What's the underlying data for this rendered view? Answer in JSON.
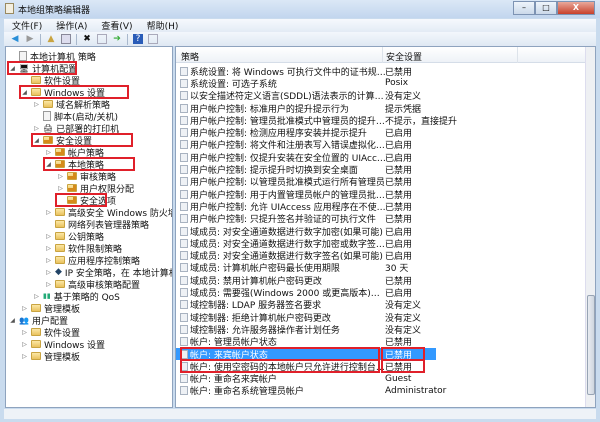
{
  "window": {
    "title": "本地组策略编辑器",
    "min": "–",
    "max": "□",
    "close": "X"
  },
  "menu": [
    "文件(F)",
    "操作(A)",
    "查看(V)",
    "帮助(H)"
  ],
  "toolbar": [
    "back-icon",
    "forward-icon",
    "up-icon",
    "show-hide-tree-icon",
    "delete-icon",
    "properties-icon",
    "export-icon",
    "help-icon",
    "view-icon"
  ],
  "tree": [
    {
      "label": "本地计算机 策略",
      "depth": 0,
      "arrow": "",
      "icon": "doc"
    },
    {
      "label": "计算机配置",
      "depth": 0,
      "arrow": "◢",
      "icon": "computer",
      "highlight": true
    },
    {
      "label": "软件设置",
      "depth": 1,
      "arrow": "",
      "icon": "folder"
    },
    {
      "label": "Windows 设置",
      "depth": 1,
      "arrow": "◢",
      "icon": "folder",
      "highlight": true
    },
    {
      "label": "域名解析策略",
      "depth": 2,
      "arrow": "▷",
      "icon": "folder"
    },
    {
      "label": "脚本(启动/关机)",
      "depth": 2,
      "arrow": "",
      "icon": "doc"
    },
    {
      "label": "已部署的打印机",
      "depth": 2,
      "arrow": "▷",
      "icon": "printer"
    },
    {
      "label": "安全设置",
      "depth": 2,
      "arrow": "◢",
      "icon": "secfolder",
      "highlight": true
    },
    {
      "label": "帐户策略",
      "depth": 3,
      "arrow": "▷",
      "icon": "secfolder"
    },
    {
      "label": "本地策略",
      "depth": 3,
      "arrow": "◢",
      "icon": "secfolder",
      "highlight": true
    },
    {
      "label": "审核策略",
      "depth": 4,
      "arrow": "▷",
      "icon": "secfolder"
    },
    {
      "label": "用户权限分配",
      "depth": 4,
      "arrow": "▷",
      "icon": "secfolder"
    },
    {
      "label": "安全选项",
      "depth": 4,
      "arrow": "",
      "icon": "secfolder",
      "highlight": true
    },
    {
      "label": "高级安全 Windows 防火墙",
      "depth": 3,
      "arrow": "▷",
      "icon": "folder"
    },
    {
      "label": "网络列表管理器策略",
      "depth": 3,
      "arrow": "",
      "icon": "folder"
    },
    {
      "label": "公钥策略",
      "depth": 3,
      "arrow": "▷",
      "icon": "folder"
    },
    {
      "label": "软件限制策略",
      "depth": 3,
      "arrow": "▷",
      "icon": "folder"
    },
    {
      "label": "应用程序控制策略",
      "depth": 3,
      "arrow": "▷",
      "icon": "folder"
    },
    {
      "label": "IP 安全策略，在 本地计算机",
      "depth": 3,
      "arrow": "▷",
      "icon": "ipsec"
    },
    {
      "label": "高级审核策略配置",
      "depth": 3,
      "arrow": "▷",
      "icon": "folder"
    },
    {
      "label": "基于策略的 QoS",
      "depth": 2,
      "arrow": "▷",
      "icon": "chart"
    },
    {
      "label": "管理模板",
      "depth": 1,
      "arrow": "▷",
      "icon": "folder"
    },
    {
      "label": "用户配置",
      "depth": 0,
      "arrow": "◢",
      "icon": "user"
    },
    {
      "label": "软件设置",
      "depth": 1,
      "arrow": "▷",
      "icon": "folder"
    },
    {
      "label": "Windows 设置",
      "depth": 1,
      "arrow": "▷",
      "icon": "folder"
    },
    {
      "label": "管理模板",
      "depth": 1,
      "arrow": "▷",
      "icon": "folder"
    }
  ],
  "list": {
    "columns": [
      "策略",
      "安全设置"
    ],
    "rows": [
      {
        "policy": "系统设置: 将 Windows 可执行文件中的证书规则用于软件...",
        "value": "已禁用"
      },
      {
        "policy": "系统设置: 可选子系统",
        "value": "Posix"
      },
      {
        "policy": "以安全描述符定义语言(SDDL)语法表示的计算机访问限制",
        "value": "没有定义"
      },
      {
        "policy": "用户帐户控制: 标准用户的提升提示行为",
        "value": "提示凭据"
      },
      {
        "policy": "用户帐户控制: 管理员批准模式中管理员的提升权限提示的...",
        "value": "不提示，直接提升"
      },
      {
        "policy": "用户帐户控制: 检测应用程序安装并提示提升",
        "value": "已启用"
      },
      {
        "policy": "用户帐户控制: 将文件和注册表写入错误虚拟化到每用户位置",
        "value": "已启用"
      },
      {
        "policy": "用户帐户控制: 仅提升安装在安全位置的 UIAccess 应用程序",
        "value": "已启用"
      },
      {
        "policy": "用户帐户控制: 提示提升时切换到安全桌面",
        "value": "已禁用"
      },
      {
        "policy": "用户帐户控制: 以管理员批准模式运行所有管理员",
        "value": "已禁用"
      },
      {
        "policy": "用户帐户控制: 用于内置管理员帐户的管理员批准模式",
        "value": "已禁用"
      },
      {
        "policy": "用户帐户控制: 允许 UIAccess 应用程序在不使用安全桌面...",
        "value": "已禁用"
      },
      {
        "policy": "用户帐户控制: 只提升签名并验证的可执行文件",
        "value": "已禁用"
      },
      {
        "policy": "域成员: 对安全通道数据进行数字加密(如果可能)",
        "value": "已启用"
      },
      {
        "policy": "域成员: 对安全通道数据进行数字加密或数字签名(始终)",
        "value": "已启用"
      },
      {
        "policy": "域成员: 对安全通道数据进行数字签名(如果可能)",
        "value": "已启用"
      },
      {
        "policy": "域成员: 计算机帐户密码最长使用期限",
        "value": "30 天"
      },
      {
        "policy": "域成员: 禁用计算机帐户密码更改",
        "value": "已禁用"
      },
      {
        "policy": "域成员: 需要强(Windows 2000 或更高版本)会话密钥",
        "value": "已启用"
      },
      {
        "policy": "域控制器: LDAP 服务器签名要求",
        "value": "没有定义"
      },
      {
        "policy": "域控制器: 拒绝计算机帐户密码更改",
        "value": "没有定义"
      },
      {
        "policy": "域控制器: 允许服务器操作者计划任务",
        "value": "没有定义"
      },
      {
        "policy": "帐户: 管理员帐户状态",
        "value": "已禁用"
      },
      {
        "policy": "帐户: 来宾帐户状态",
        "value": "已禁用",
        "selected": true,
        "highlight": true
      },
      {
        "policy": "帐户: 使用空密码的本地帐户只允许进行控制台登录",
        "value": "已禁用",
        "highlight": true
      },
      {
        "policy": "帐户: 重命名来宾帐户",
        "value": "Guest"
      },
      {
        "policy": "帐户: 重命名系统管理员帐户",
        "value": "Administrator"
      }
    ]
  },
  "colors": {
    "highlight_box": "#e0202a",
    "selection": "#3399ff"
  }
}
